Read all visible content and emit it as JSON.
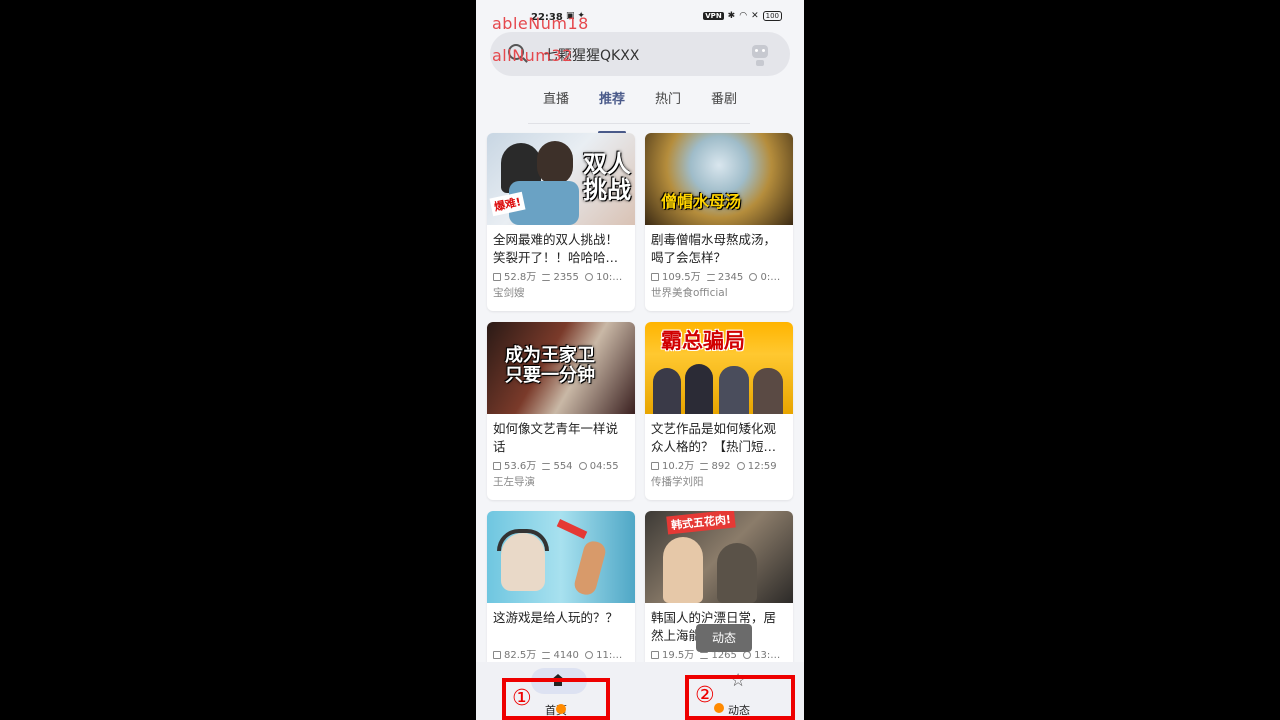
{
  "status": {
    "time": "22:38",
    "left_icons": "▣ ✦",
    "vpn": "VPN",
    "bt": "✱",
    "wifi": "◠",
    "close": "✕",
    "battery": "100"
  },
  "debug": {
    "line1": "ableNum18",
    "line2": "allNum32"
  },
  "search": {
    "text": "七颗猩猩QKXX"
  },
  "tabs": [
    {
      "label": "直播"
    },
    {
      "label": "推荐"
    },
    {
      "label": "热门"
    },
    {
      "label": "番剧"
    }
  ],
  "cards": [
    {
      "thumb_text": "双人\n挑战",
      "badge": "爆难!",
      "title": "全网最难的双人挑战！笑裂开了！！哈哈哈…",
      "views": "52.8万",
      "danmaku": "2355",
      "duration": "10:…",
      "author": "宝剑嫂"
    },
    {
      "thumb_text": "僧帽水母汤",
      "title": "剧毒僧帽水母熬成汤，喝了会怎样？",
      "views": "109.5万",
      "danmaku": "2345",
      "duration": "0:…",
      "author": "世界美食official"
    },
    {
      "thumb_text": "成为王家卫\n只要一分钟",
      "title": "如何像文艺青年一样说话",
      "views": "53.6万",
      "danmaku": "554",
      "duration": "04:55",
      "author": "王左导演"
    },
    {
      "thumb_text": "霸总骗局",
      "title": "文艺作品是如何矮化观众人格的？【热门短…",
      "views": "10.2万",
      "danmaku": "892",
      "duration": "12:59",
      "author": "传播学刘阳"
    },
    {
      "thumb_text": "",
      "title": "这游戏是给人玩的？？",
      "views": "82.5万",
      "danmaku": "4140",
      "duration": "11:…",
      "author": ""
    },
    {
      "thumb_text": "韩式五花肉!",
      "title": "韩国人的沪漂日常，居然上海能…么正…",
      "views": "19.5万",
      "danmaku": "1265",
      "duration": "13:…",
      "author": ""
    }
  ],
  "toast": "动态",
  "nav": {
    "home": "首页",
    "dynamic": "动态"
  },
  "annotations": {
    "one": "①",
    "two": "②"
  },
  "colors": {
    "accent": "#4a5a8a",
    "annotation": "#ee0000",
    "tap_dot": "#ff8a00"
  }
}
